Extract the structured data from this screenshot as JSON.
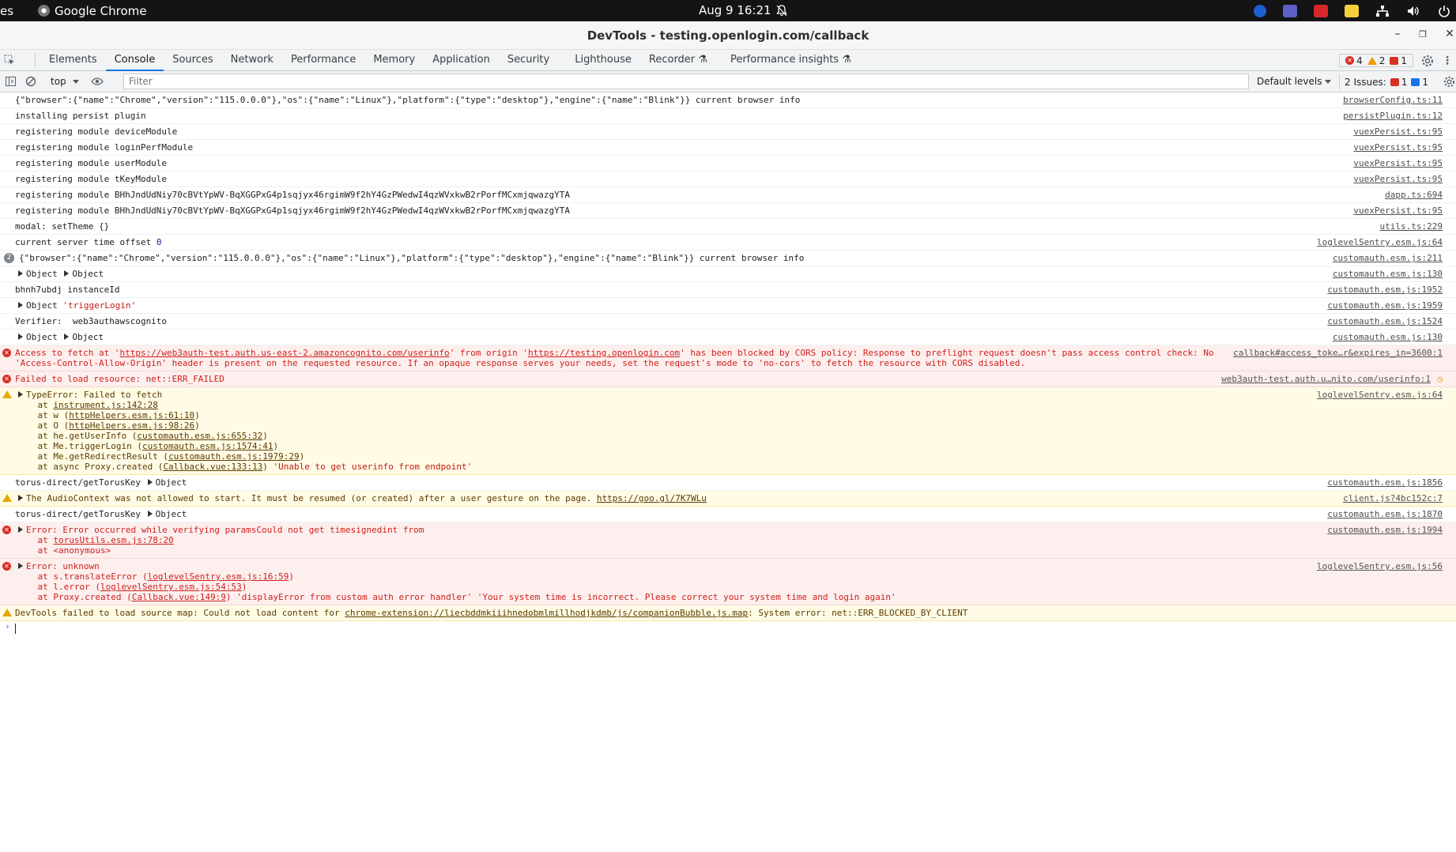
{
  "os_bar": {
    "activities": "es",
    "app_name": "Google Chrome",
    "clock": "Aug 9  16:21"
  },
  "window": {
    "title": "DevTools - testing.openlogin.com/callback"
  },
  "tabs": [
    "Elements",
    "Console",
    "Sources",
    "Network",
    "Performance",
    "Memory",
    "Application",
    "Security",
    "Lighthouse",
    "Recorder",
    "Performance insights"
  ],
  "counters": {
    "errors": "4",
    "warnings": "2",
    "issues_red": "1"
  },
  "toolbar": {
    "context": "top",
    "filter_placeholder": "Filter",
    "levels": "Default levels",
    "issues_label": "2 Issues:",
    "issues_red": "1",
    "issues_blue": "1"
  },
  "colors": {
    "accent": "#1a73e8",
    "error": "#d93025",
    "warning": "#f29900"
  },
  "console": {
    "r1": {
      "text": "{\"browser\":{\"name\":\"Chrome\",\"version\":\"115.0.0.0\"},\"os\":{\"name\":\"Linux\"},\"platform\":{\"type\":\"desktop\"},\"engine\":{\"name\":\"Blink\"}} current browser info",
      "src": "browserConfig.ts:11"
    },
    "r2": {
      "text": "installing persist plugin",
      "src": "persistPlugin.ts:12"
    },
    "r3": {
      "text": "registering module deviceModule",
      "src": "vuexPersist.ts:95"
    },
    "r4": {
      "text": "registering module loginPerfModule",
      "src": "vuexPersist.ts:95"
    },
    "r5": {
      "text": "registering module userModule",
      "src": "vuexPersist.ts:95"
    },
    "r6": {
      "text": "registering module tKeyModule",
      "src": "vuexPersist.ts:95"
    },
    "r7": {
      "text": "registering module BHhJndUdNiy70cBVtYpWV-BqXGGPxG4p1sqjyx46rgimW9f2hY4GzPWedwI4qzWVxkwB2rPorfMCxmjqwazgYTA",
      "src": "dapp.ts:694"
    },
    "r8": {
      "text": "registering module BHhJndUdNiy70cBVtYpWV-BqXGGPxG4p1sqjyx46rgimW9f2hY4GzPWedwI4qzWVxkwB2rPorfMCxmjqwazgYTA",
      "src": "vuexPersist.ts:95"
    },
    "r9": {
      "text": "modal: setTheme {}",
      "src": "utils.ts:229"
    },
    "r10": {
      "text": "current server time offset ",
      "value": "0",
      "src": "loglevelSentry.esm.js:64"
    },
    "r11": {
      "count": "2",
      "text": "{\"browser\":{\"name\":\"Chrome\",\"version\":\"115.0.0.0\"},\"os\":{\"name\":\"Linux\"},\"platform\":{\"type\":\"desktop\"},\"engine\":{\"name\":\"Blink\"}} current browser info",
      "src": "customauth.esm.js:211"
    },
    "r12": {
      "a": "Object",
      "b": "Object",
      "src": "customauth.esm.js:130"
    },
    "r13": {
      "text": "bhnh7ubdj instanceId",
      "src": "customauth.esm.js:1952"
    },
    "r14": {
      "a": "Object",
      "str": "'triggerLogin'",
      "src": "customauth.esm.js:1959"
    },
    "r15": {
      "text": "Verifier:  web3authawscognito",
      "src": "customauth.esm.js:1524"
    },
    "r16": {
      "a": "Object",
      "b": "Object",
      "src": "customauth.esm.js:130"
    },
    "e1": {
      "p1": "Access to fetch at '",
      "link1": "https://web3auth-test.auth.us-east-2.amazoncognito.com/userinfo",
      "p2": "' from origin '",
      "link2": "https://testing.openlogin.com",
      "p3": "' has been blocked by CORS policy: Response to preflight request doesn't pass access control check: No",
      "line2": "'Access-Control-Allow-Origin' header is present on the requested resource. If an opaque response serves your needs, set the request's mode to 'no-cors' to fetch the resource with CORS disabled.",
      "src": "callback#access_toke…r&expires_in=3600:1"
    },
    "e2": {
      "text": "Failed to load resource: net::ERR_FAILED",
      "src": "web3auth-test.auth.u…nito.com/userinfo:1"
    },
    "w1": {
      "head": "TypeError: Failed to fetch",
      "s1a": "    at ",
      "s1b": "instrument.js:142:28",
      "s2a": "    at w (",
      "s2b": "httpHelpers.esm.js:61:10",
      "s2c": ")",
      "s3a": "    at O (",
      "s3b": "httpHelpers.esm.js:98:26",
      "s3c": ")",
      "s4a": "    at he.getUserInfo (",
      "s4b": "customauth.esm.js:655:32",
      "s4c": ")",
      "s5a": "    at Me.triggerLogin (",
      "s5b": "customauth.esm.js:1574:41",
      "s5c": ")",
      "s6a": "    at Me.getRedirectResult (",
      "s6b": "customauth.esm.js:1979:29",
      "s6c": ")",
      "s7a": "    at async Proxy.created (",
      "s7b": "Callback.vue:133:13",
      "s7c": ") ",
      "s7d": "'Unable to get userinfo from endpoint'",
      "src": "loglevelSentry.esm.js:64"
    },
    "r17": {
      "text": "torus-direct/getTorusKey ",
      "a": "Object",
      "src": "customauth.esm.js:1856"
    },
    "w2": {
      "text": "The AudioContext was not allowed to start. It must be resumed (or created) after a user gesture on the page. ",
      "link": "https://goo.gl/7K7WLu",
      "src": "client.js?4bc152c:7"
    },
    "r18": {
      "text": "torus-direct/getTorusKey ",
      "a": "Object",
      "src": "customauth.esm.js:1870"
    },
    "e3": {
      "head": "Error: Error occurred while verifying paramsCould not get timesignedint from",
      "s1a": "    at ",
      "s1b": "torusUtils.esm.js:78:20",
      "s2": "    at <anonymous>",
      "src": "customauth.esm.js:1994"
    },
    "e4": {
      "head": "Error: unknown",
      "s1a": "    at s.translateError (",
      "s1b": "loglevelSentry.esm.js:16:59",
      "s1c": ")",
      "s2a": "    at l.error (",
      "s2b": "loglevelSentry.esm.js:54:53",
      "s2c": ")",
      "s3a": "    at Proxy.created (",
      "s3b": "Callback.vue:149:9",
      "s3c": ") 'displayError from custom auth error handler' 'Your system time is incorrect. Please correct your system time and login again'",
      "src": "loglevelSentry.esm.js:56"
    },
    "w3": {
      "p1": "DevTools failed to load source map: Could not load content for ",
      "link": "chrome-extension://liecbddmkiiihnedobmlmillhodjkdmb/js/companionBubble.js.map",
      "p2": ": System error: net::ERR_BLOCKED_BY_CLIENT"
    }
  }
}
